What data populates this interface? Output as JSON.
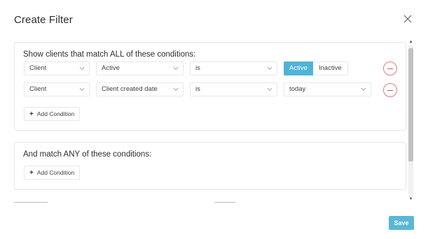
{
  "modal": {
    "title": "Create Filter",
    "close_icon": "close-icon"
  },
  "match_all": {
    "heading": "Show clients that match ALL of these conditions:",
    "conditions": [
      {
        "entity": "Client",
        "field": "Active",
        "operator": "is",
        "value_type": "toggle",
        "toggle": {
          "active_label": "Active",
          "inactive_label": "Inactive",
          "selected": "Active"
        }
      },
      {
        "entity": "Client",
        "field": "Client created date",
        "operator": "is",
        "value_type": "select",
        "value": "today"
      }
    ],
    "add_label": "Add Condition"
  },
  "match_any": {
    "heading": "And match ANY of these conditions:",
    "add_label": "Add Condition"
  },
  "footer": {
    "save_label": "Save"
  },
  "colors": {
    "accent": "#4fb3d8",
    "remove": "#d9534f",
    "border": "#e3e6ea"
  }
}
